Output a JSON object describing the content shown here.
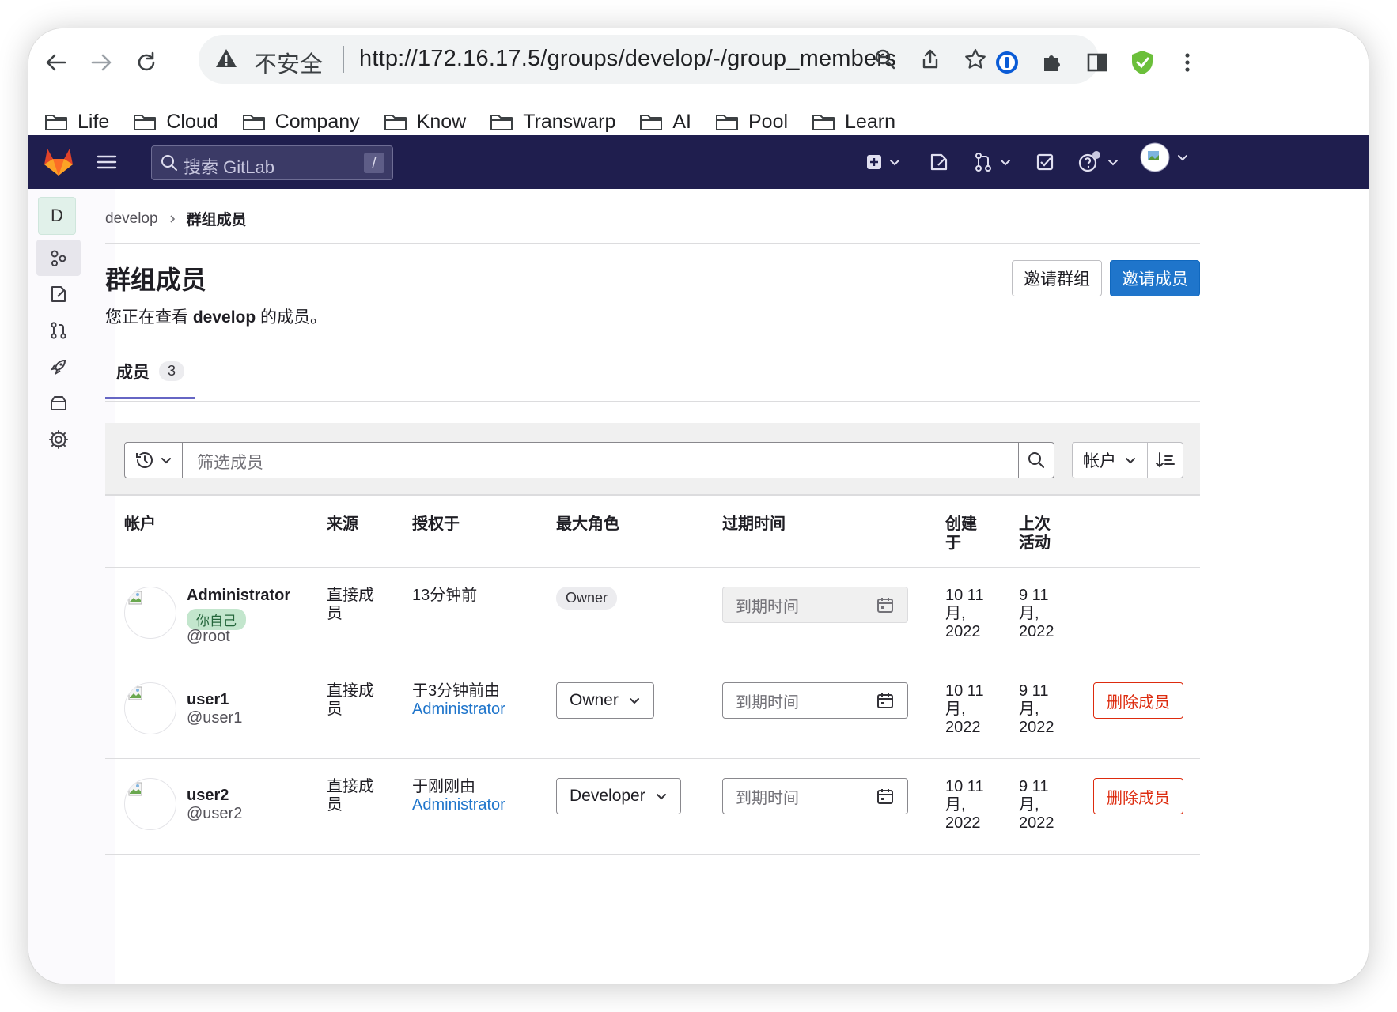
{
  "browser": {
    "security_label": "不安全",
    "url": "http://172.16.17.5/groups/develop/-/group_members",
    "bookmarks": [
      "Life",
      "Cloud",
      "Company",
      "Know",
      "Transwarp",
      "AI",
      "Pool",
      "Learn"
    ]
  },
  "gitlab_header": {
    "search_placeholder": "搜索 GitLab",
    "search_shortcut": "/"
  },
  "sidebar": {
    "group_avatar_letter": "D",
    "items": [
      "group-members-icon",
      "issues-icon",
      "merge-requests-icon",
      "deployments-icon",
      "packages-icon",
      "settings-icon"
    ]
  },
  "breadcrumb": {
    "parent": "develop",
    "current": "群组成员"
  },
  "page": {
    "title": "群组成员",
    "subtitle_prefix": "您正在查看",
    "subtitle_group": "develop",
    "subtitle_suffix": "的成员。",
    "invite_group_button": "邀请群组",
    "invite_member_button": "邀请成员"
  },
  "tabs": [
    {
      "label": "成员",
      "count": "3"
    }
  ],
  "filter": {
    "placeholder": "筛选成员",
    "sort_field": "帐户"
  },
  "table": {
    "headers": {
      "account": "帐户",
      "source": "来源",
      "granted": "授权于",
      "max_role": "最大角色",
      "expiration": "过期时间",
      "created": [
        "创建",
        "于"
      ],
      "last_activity": [
        "上次",
        "活动"
      ]
    },
    "rows": [
      {
        "name": "Administrator",
        "badge": "你自己",
        "username": "@root",
        "source": [
          "直接成",
          "员"
        ],
        "granted": "13分钟前",
        "granted_by": "",
        "role": "Owner",
        "role_editable": false,
        "expiration_placeholder": "到期时间",
        "created": [
          "10 11",
          "月,",
          "2022"
        ],
        "last_activity": [
          "9 11",
          "月,",
          "2022"
        ],
        "remove_label": ""
      },
      {
        "name": "user1",
        "badge": "",
        "username": "@user1",
        "source": [
          "直接成",
          "员"
        ],
        "granted": "于3分钟前由",
        "granted_by": "Administrator",
        "role": "Owner",
        "role_editable": true,
        "expiration_placeholder": "到期时间",
        "created": [
          "10 11",
          "月,",
          "2022"
        ],
        "last_activity": [
          "9 11",
          "月,",
          "2022"
        ],
        "remove_label": "删除成员"
      },
      {
        "name": "user2",
        "badge": "",
        "username": "@user2",
        "source": [
          "直接成",
          "员"
        ],
        "granted": "于刚刚由",
        "granted_by": "Administrator",
        "role": "Developer",
        "role_editable": true,
        "expiration_placeholder": "到期时间",
        "created": [
          "10 11",
          "月,",
          "2022"
        ],
        "last_activity": [
          "9 11",
          "月,",
          "2022"
        ],
        "remove_label": "删除成员"
      }
    ]
  },
  "colors": {
    "gitlab_nav": "#1f1e4e",
    "primary": "#1f75cb",
    "danger": "#dd2b0e",
    "tab_underline": "#6666c4",
    "self_badge_bg": "#c3e6cd"
  }
}
